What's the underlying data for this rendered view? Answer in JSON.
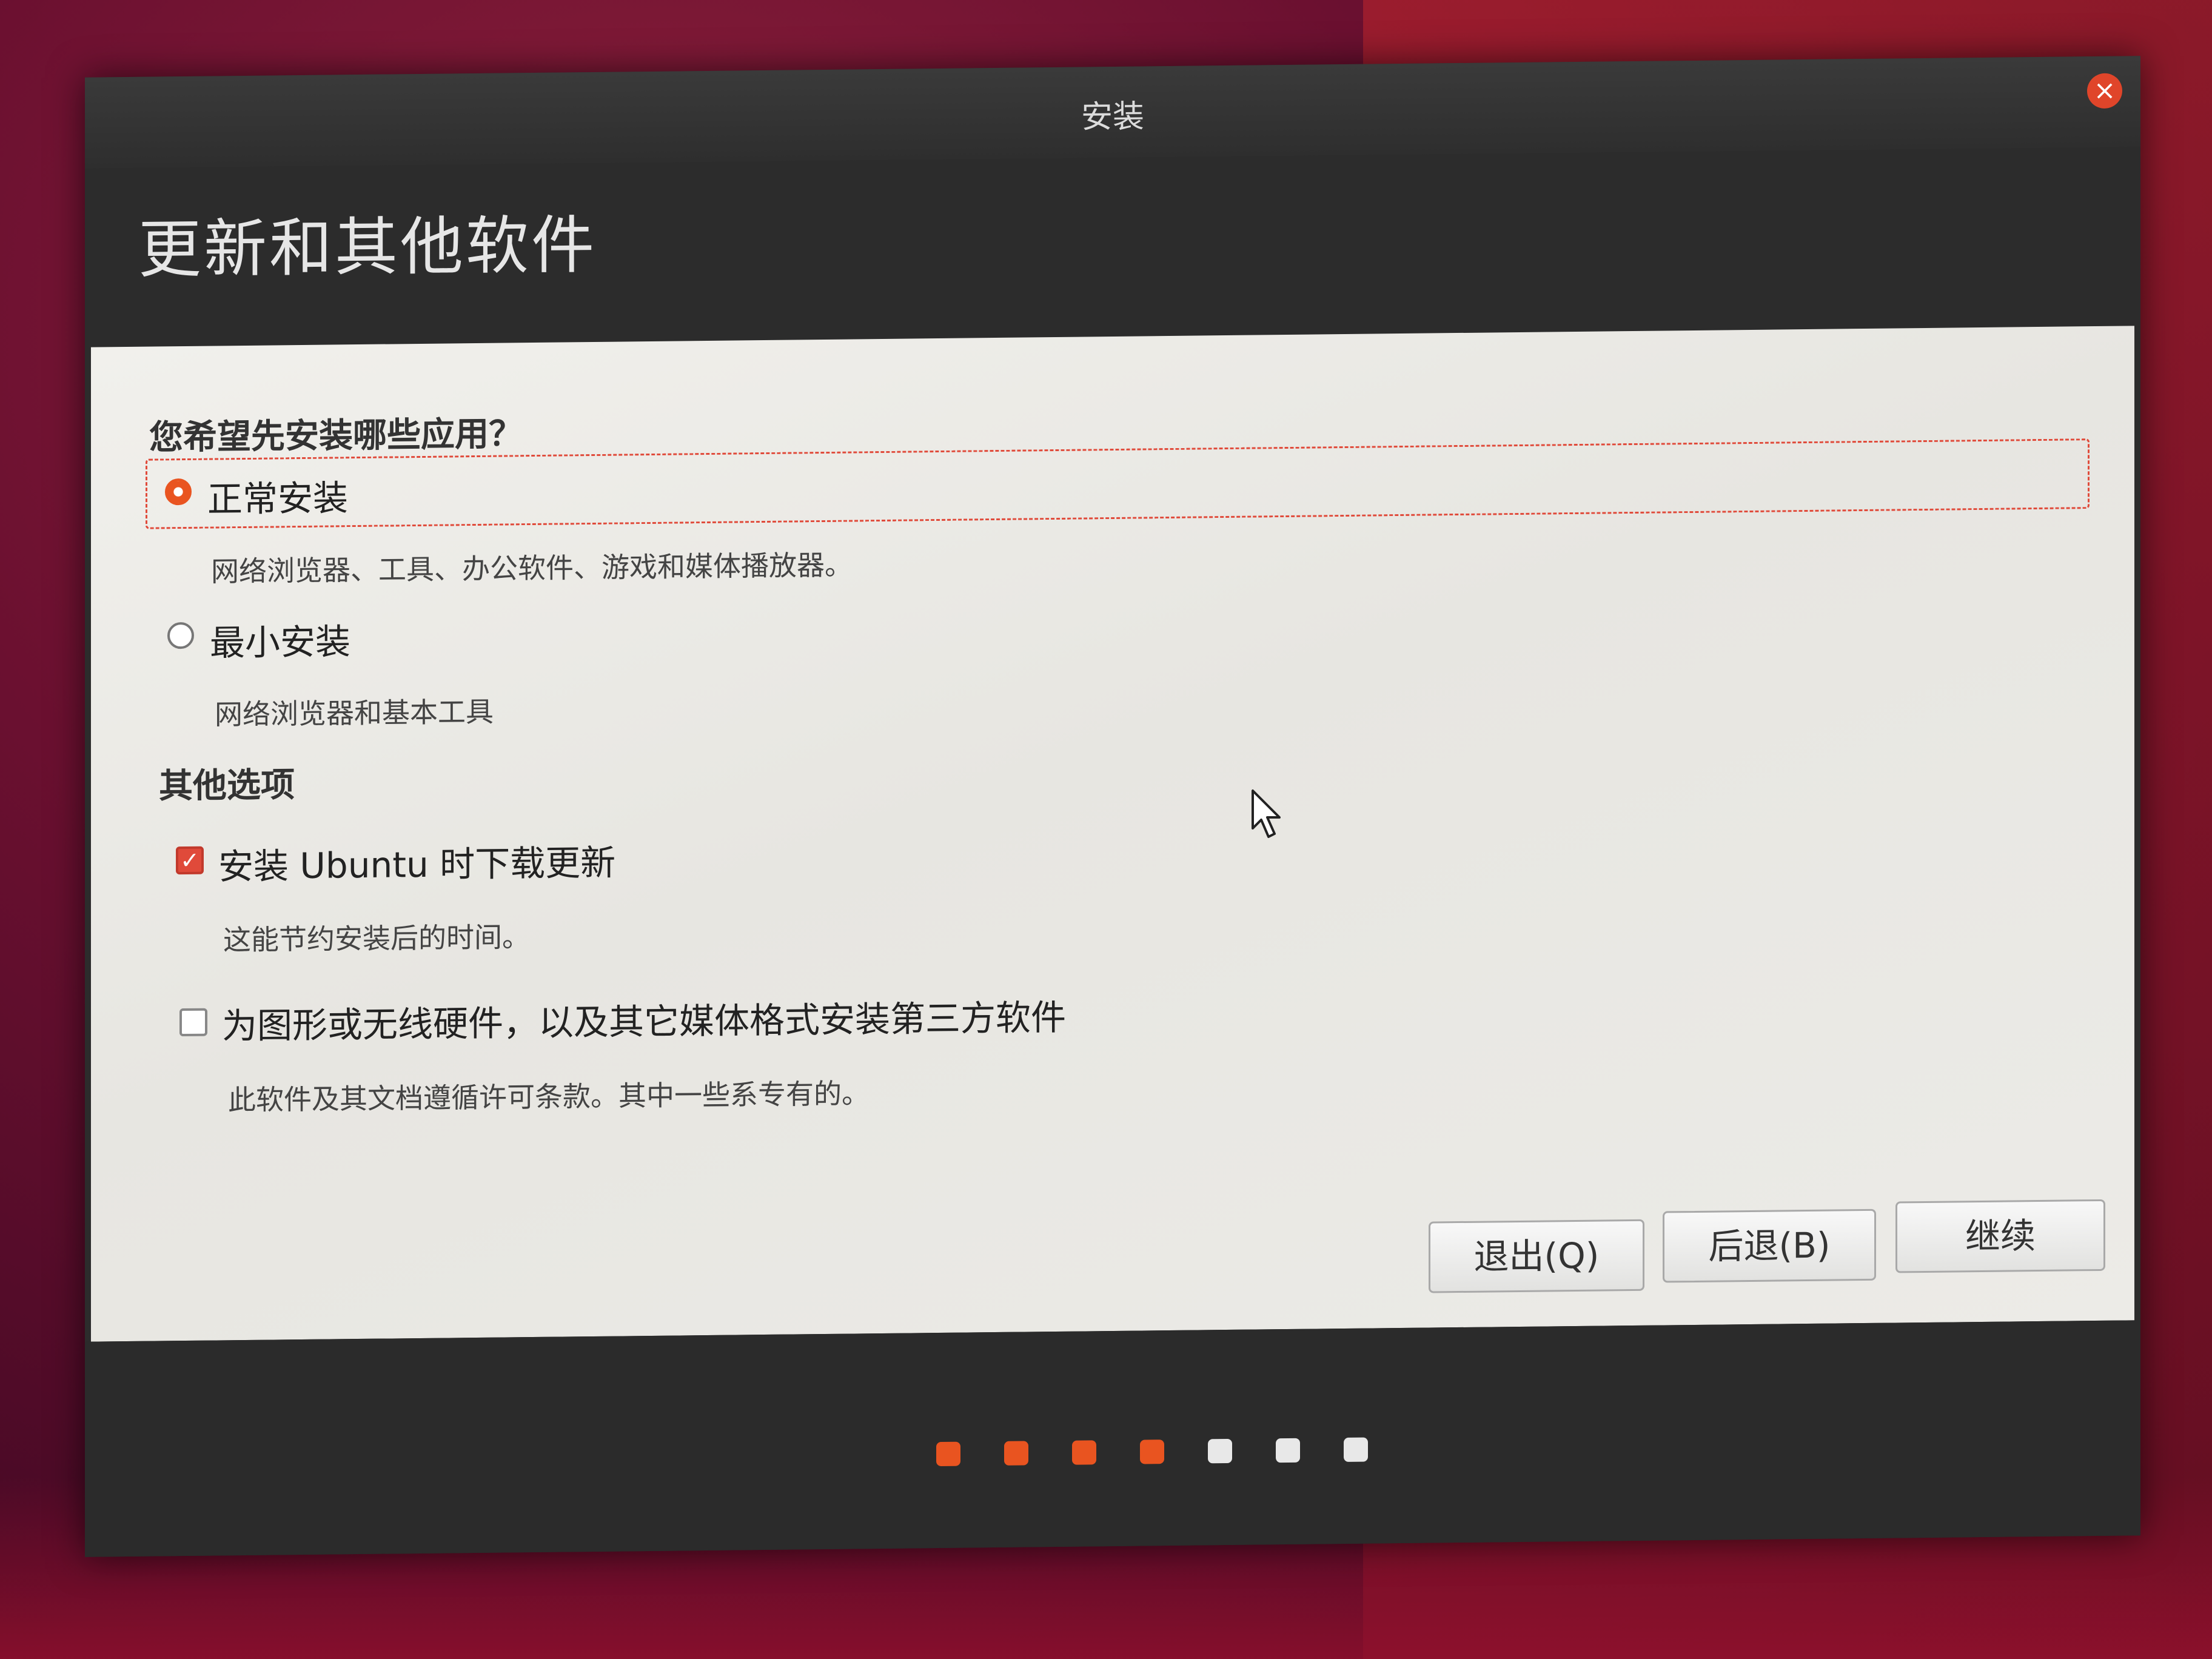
{
  "window": {
    "title": "安装",
    "close_symbol": "×"
  },
  "page": {
    "title": "更新和其他软件"
  },
  "install_type": {
    "question": "您希望先安装哪些应用？",
    "options": [
      {
        "label": "正常安装",
        "description": "网络浏览器、工具、办公软件、游戏和媒体播放器。",
        "selected": true
      },
      {
        "label": "最小安装",
        "description": "网络浏览器和基本工具",
        "selected": false
      }
    ]
  },
  "other_options": {
    "heading": "其他选项",
    "items": [
      {
        "label": "安装 Ubuntu 时下载更新",
        "description": "这能节约安装后的时间。",
        "checked": true,
        "check_symbol": "✓"
      },
      {
        "label": "为图形或无线硬件，以及其它媒体格式安装第三方软件",
        "description": "此软件及其文档遵循许可条款。其中一些系专有的。",
        "checked": false
      }
    ]
  },
  "buttons": {
    "quit": "退出(Q)",
    "back": "后退(B)",
    "continue": "继续"
  },
  "progress": {
    "total_steps": 7,
    "completed_steps": 4,
    "active_color": "#e95420",
    "inactive_color": "#e8e8e8"
  },
  "icons": {
    "close": "close-icon",
    "cursor": "mouse-pointer-icon"
  }
}
